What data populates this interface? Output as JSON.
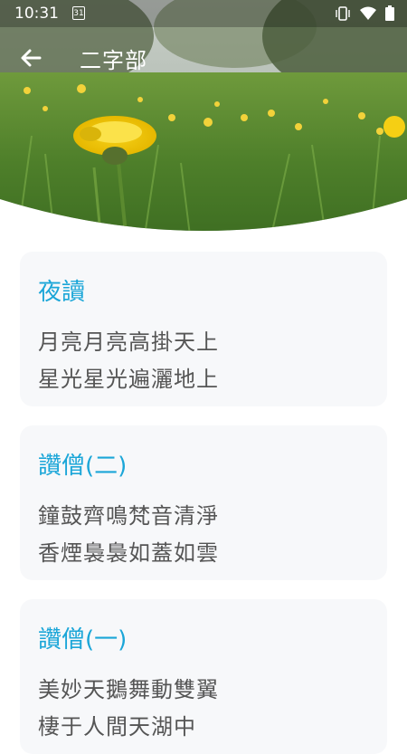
{
  "status_bar": {
    "time": "10:31",
    "calendar_day": "31"
  },
  "app_bar": {
    "title": "二字部"
  },
  "poems": [
    {
      "title": "夜讀",
      "lines": [
        "月亮月亮高掛天上",
        "星光星光遍灑地上"
      ]
    },
    {
      "title": "讚僧(二)",
      "lines": [
        "鐘鼓齊鳴梵音清淨",
        "香煙裊裊如蓋如雲"
      ]
    },
    {
      "title": "讚僧(一)",
      "lines": [
        "美妙天鵝舞動雙翼",
        "棲于人間天湖中"
      ]
    }
  ],
  "colors": {
    "accent": "#1ba6d8",
    "card_bg": "#f7f8fa",
    "text": "#555555"
  }
}
